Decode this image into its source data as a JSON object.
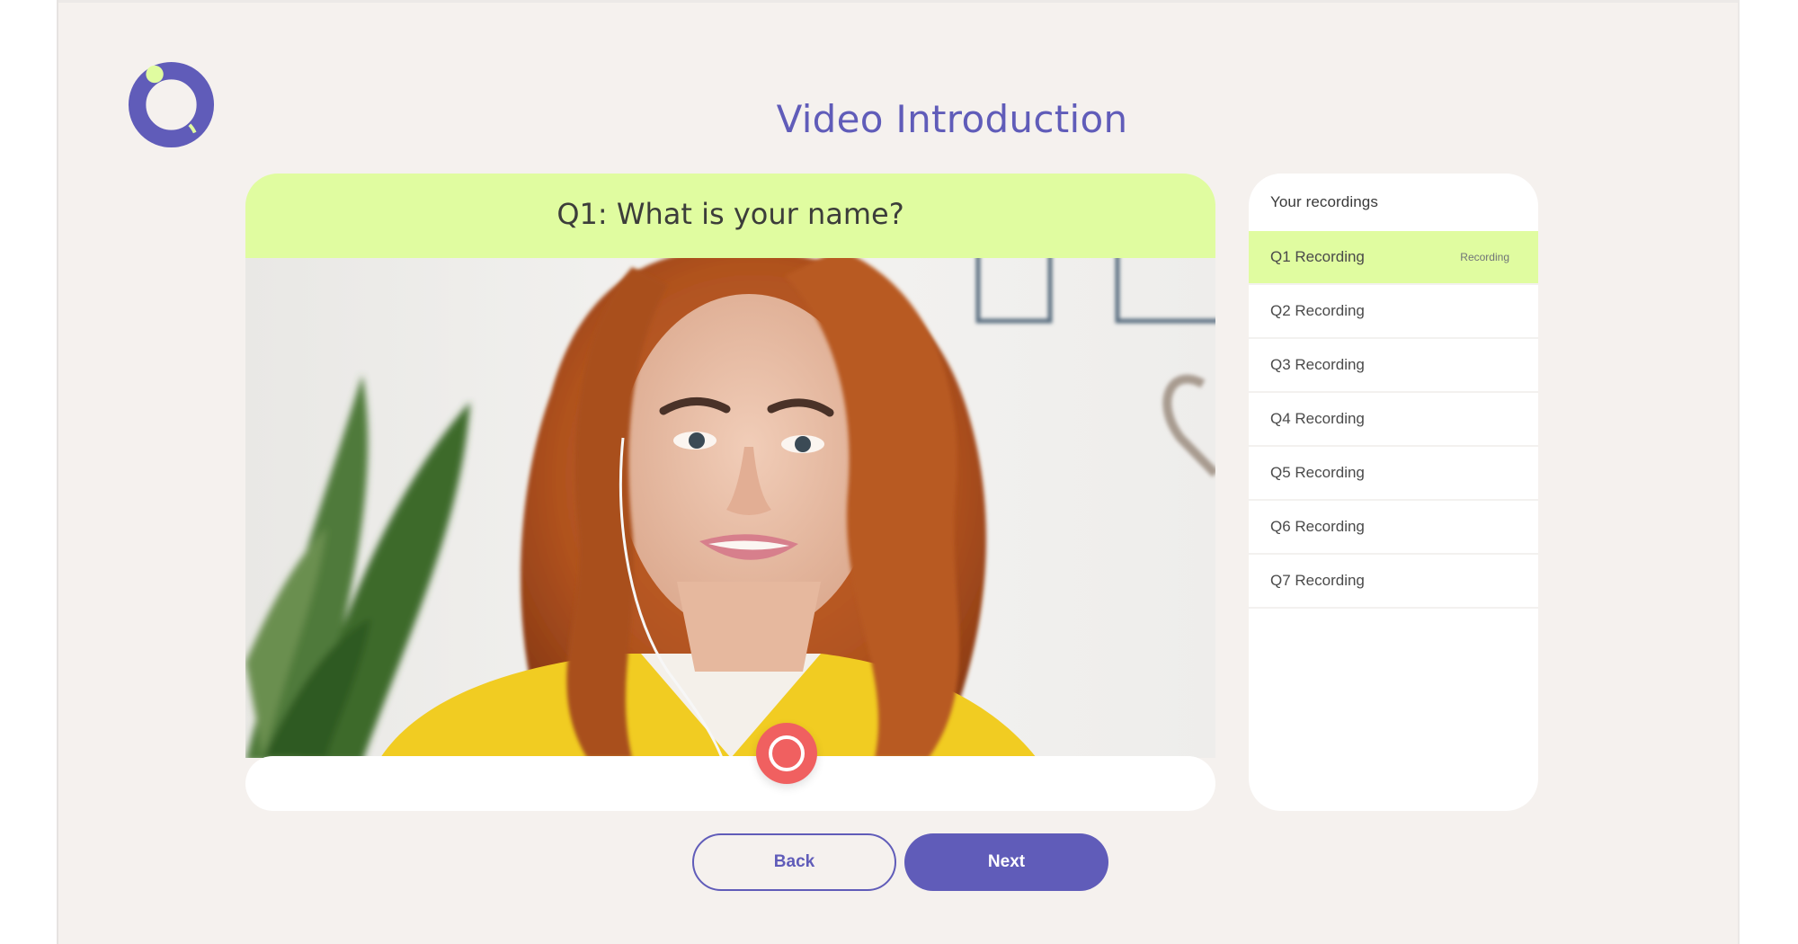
{
  "page": {
    "title": "Video Introduction"
  },
  "brand": {
    "logo_icon": "ring-logo-icon",
    "primary_color": "#605cb9",
    "accent_color": "#e0fca0",
    "record_color": "#f06060"
  },
  "question": {
    "text": "Q1: What is your name?"
  },
  "video": {
    "record_button_icon": "record-icon"
  },
  "recordings": {
    "header": "Your recordings",
    "items": [
      {
        "label": "Q1 Recording",
        "status": "Recording",
        "active": true
      },
      {
        "label": "Q2 Recording",
        "status": "",
        "active": false
      },
      {
        "label": "Q3 Recording",
        "status": "",
        "active": false
      },
      {
        "label": "Q4 Recording",
        "status": "",
        "active": false
      },
      {
        "label": "Q5 Recording",
        "status": "",
        "active": false
      },
      {
        "label": "Q6 Recording",
        "status": "",
        "active": false
      },
      {
        "label": "Q7 Recording",
        "status": "",
        "active": false
      }
    ]
  },
  "navigation": {
    "back_label": "Back",
    "next_label": "Next"
  }
}
